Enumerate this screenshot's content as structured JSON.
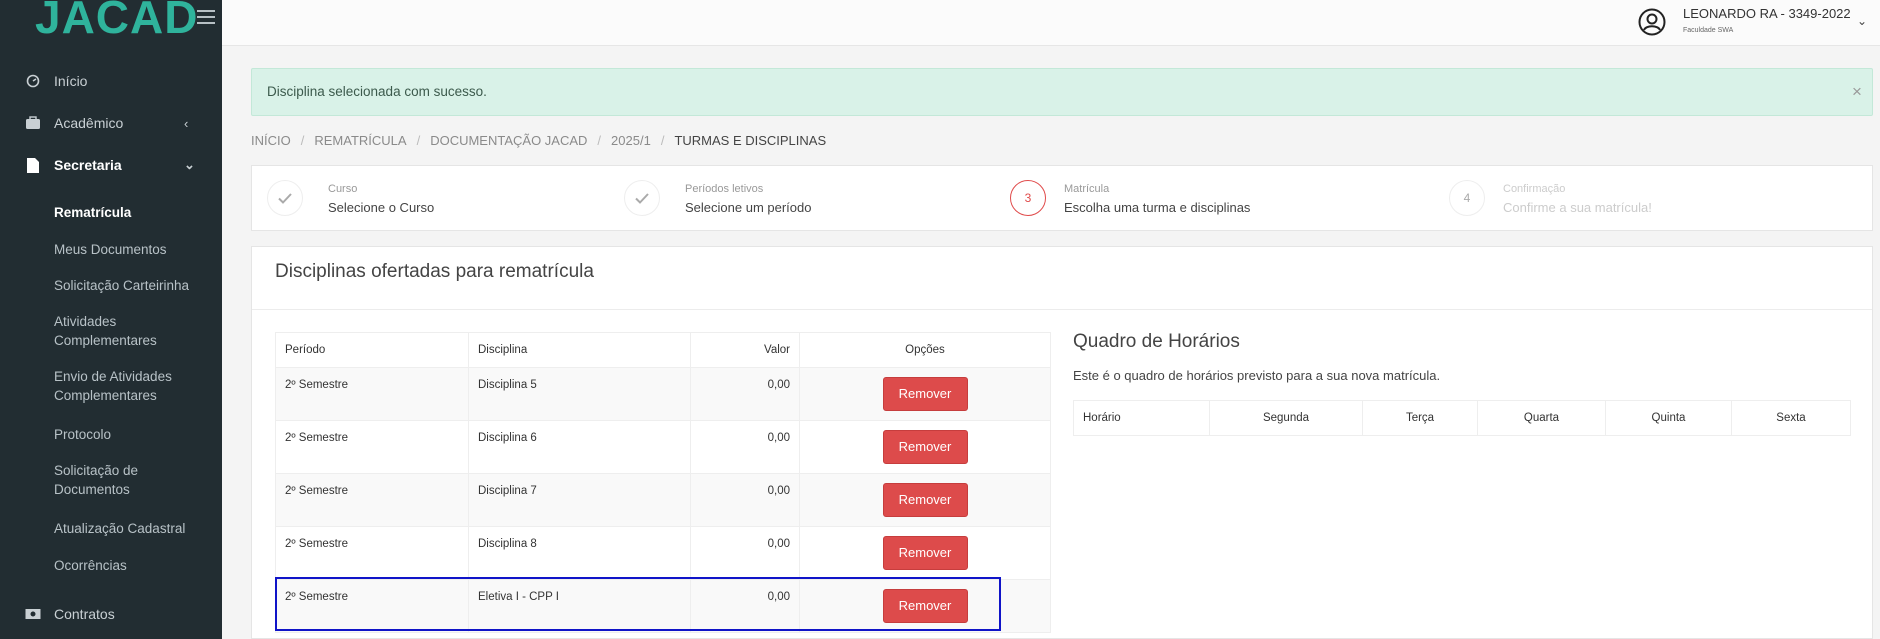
{
  "sidebar": {
    "logo": "JACAD",
    "items": {
      "inicio": "Início",
      "academico": "Acadêmico",
      "secretaria": "Secretaria",
      "contratos": "Contratos"
    },
    "subitems": [
      "Rematrícula",
      "Meus Documentos",
      "Solicitação Carteirinha",
      "Atividades Complementares",
      "Envio de Atividades Complementares",
      "Protocolo",
      "Solicitação de Documentos",
      "Atualização Cadastral",
      "Ocorrências"
    ]
  },
  "header": {
    "user_name": "LEONARDO RA - 3349-2022",
    "institution": "Faculdade SWA"
  },
  "alert": {
    "message": "Disciplina selecionada com sucesso.",
    "close": "×"
  },
  "breadcrumb": [
    "INÍCIO",
    "REMATRÍCULA",
    "DOCUMENTAÇÃO JACAD",
    "2025/1",
    "TURMAS E DISCIPLINAS"
  ],
  "steps": [
    {
      "number": "",
      "label": "Curso",
      "description": "Selecione o Curso",
      "state": "done"
    },
    {
      "number": "",
      "label": "Períodos letivos",
      "description": "Selecione um período",
      "state": "done"
    },
    {
      "number": "3",
      "label": "Matrícula",
      "description": "Escolha uma turma e disciplinas",
      "state": "current"
    },
    {
      "number": "4",
      "label": "Confirmação",
      "description": "Confirme a sua matrícula!",
      "state": "disabled"
    }
  ],
  "panel": {
    "title": "Disciplinas ofertadas para rematrícula",
    "table": {
      "headers": {
        "periodo": "Período",
        "disciplina": "Disciplina",
        "valor": "Valor",
        "opcoes": "Opções"
      },
      "rows": [
        {
          "periodo": "2º Semestre",
          "disciplina": "Disciplina 5",
          "valor": "0,00",
          "action": "Remover"
        },
        {
          "periodo": "2º Semestre",
          "disciplina": "Disciplina 6",
          "valor": "0,00",
          "action": "Remover"
        },
        {
          "periodo": "2º Semestre",
          "disciplina": "Disciplina 7",
          "valor": "0,00",
          "action": "Remover"
        },
        {
          "periodo": "2º Semestre",
          "disciplina": "Disciplina 8",
          "valor": "0,00",
          "action": "Remover"
        },
        {
          "periodo": "2º Semestre",
          "disciplina": "Eletiva I - CPP I",
          "valor": "0,00",
          "action": "Remover"
        }
      ]
    }
  },
  "schedule": {
    "title": "Quadro de Horários",
    "description": "Este é o quadro de horários previsto para a sua nova matrícula.",
    "headers": [
      "Horário",
      "Segunda",
      "Terça",
      "Quarta",
      "Quinta",
      "Sexta"
    ]
  },
  "colors": {
    "sidebar_bg": "#222d32",
    "brand": "#2fb39c",
    "danger": "#dd4b4b",
    "alert_bg": "#d9f2e8",
    "highlight": "#1014c8"
  }
}
